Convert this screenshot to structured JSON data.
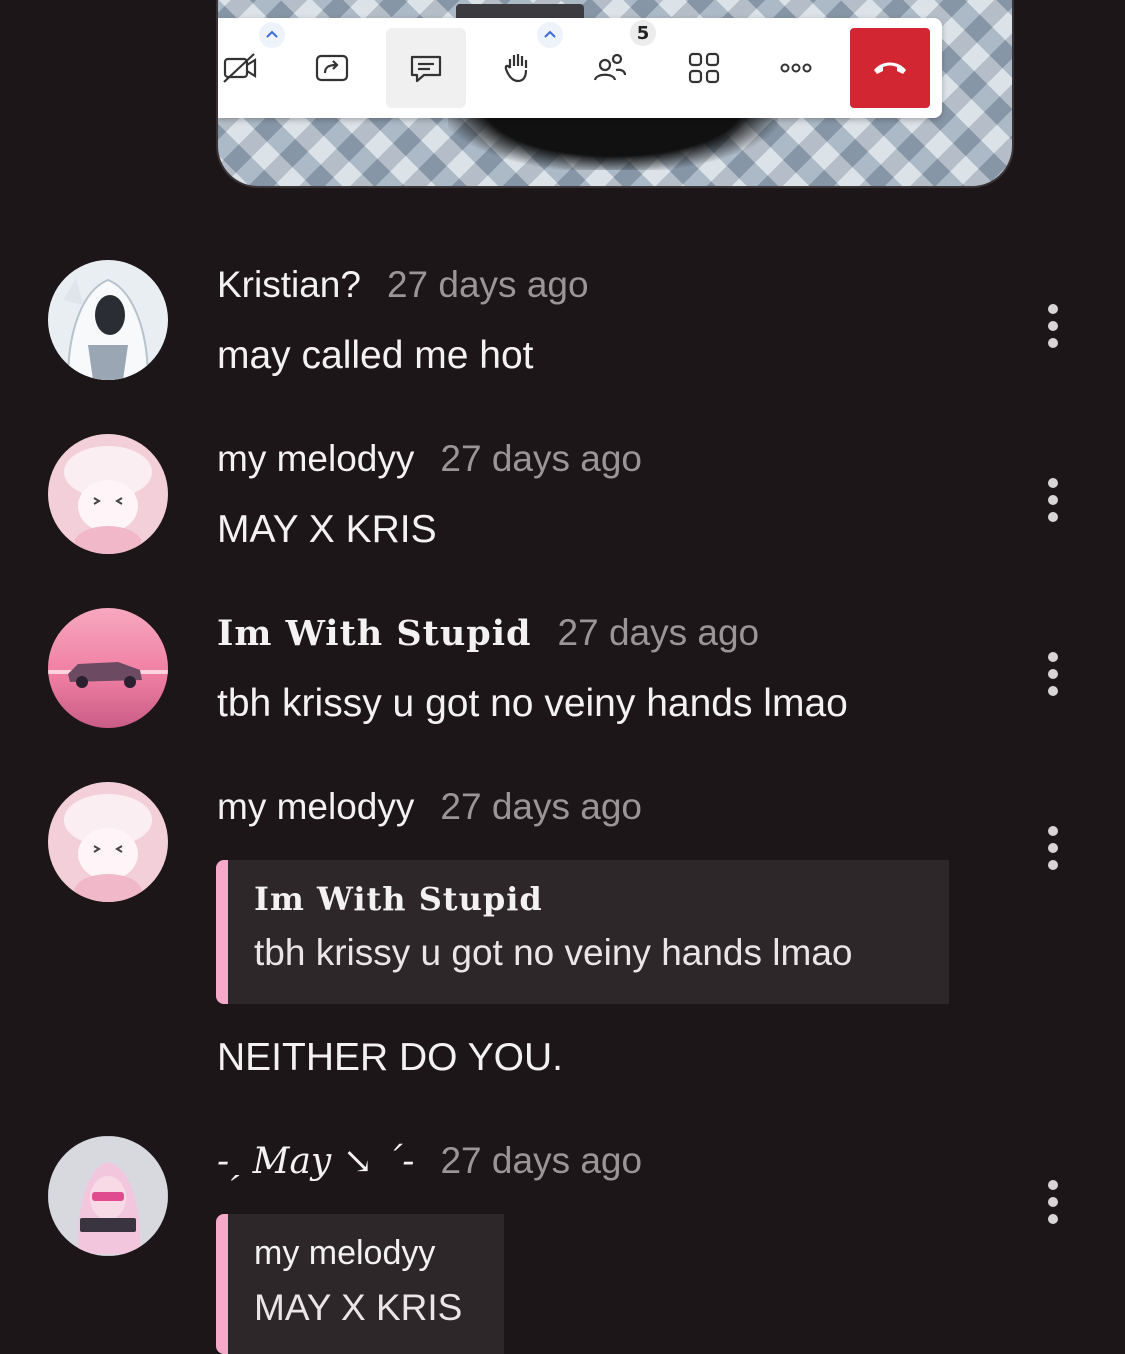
{
  "toolbar": {
    "buttons": [
      {
        "name": "camera-off-icon"
      },
      {
        "name": "share-screen-icon"
      },
      {
        "name": "chat-icon"
      },
      {
        "name": "raise-hand-icon"
      },
      {
        "name": "participants-icon"
      },
      {
        "name": "view-grid-icon"
      },
      {
        "name": "more-options-icon"
      },
      {
        "name": "end-call-icon"
      }
    ],
    "participants_count": "5",
    "end_call_color": "#d32633"
  },
  "comments": [
    {
      "author": "Kristian?",
      "time": "27 days ago",
      "text": "may called me hot"
    },
    {
      "author": "my melodyy",
      "time": "27 days ago",
      "text": "MAY X KRIS"
    },
    {
      "author": "Im With Stupid",
      "time": "27 days ago",
      "text": "tbh krissy u got no veiny hands lmao"
    },
    {
      "author": "my melodyy",
      "time": "27 days ago",
      "reply_to": {
        "author": "Im With Stupid",
        "text": "tbh krissy u got no veiny hands lmao"
      },
      "text": "NEITHER DO YOU."
    },
    {
      "author": "-ˏ May ↘ ˊ-",
      "time": "27 days ago",
      "reply_to": {
        "author": "my melodyy",
        "text": "MAY X KRIS"
      }
    }
  ],
  "colors": {
    "background": "#1c1618",
    "quote_accent": "#f6a9c9",
    "quote_background": "#2d2729",
    "timestamp": "#9b9598"
  }
}
